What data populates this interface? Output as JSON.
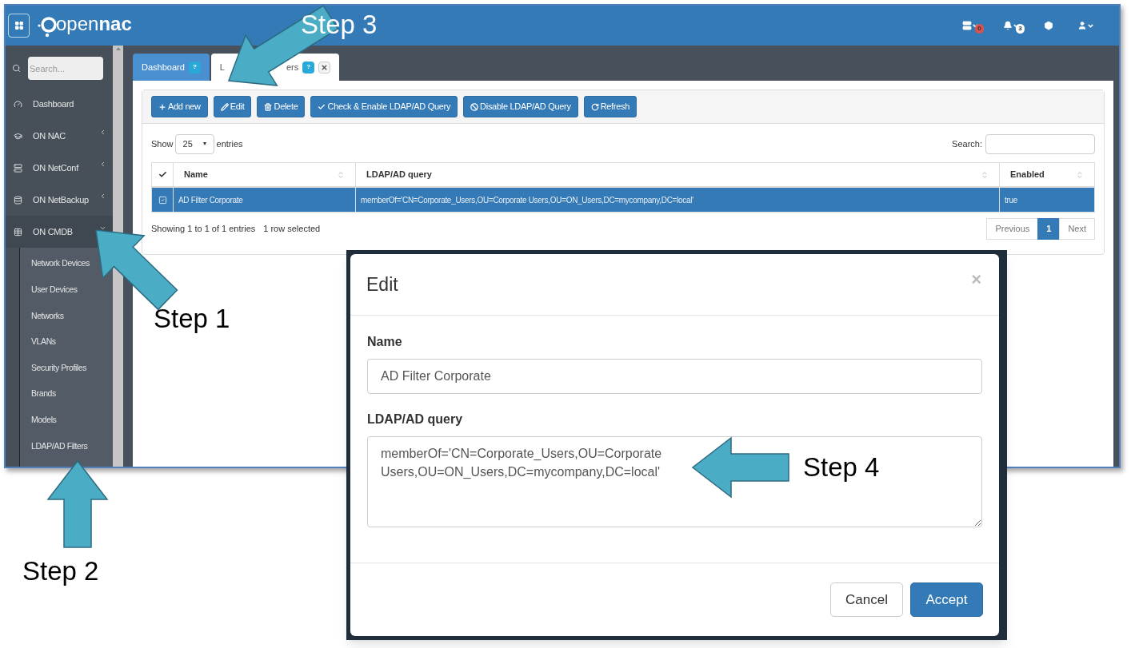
{
  "header": {
    "logo": "open**nac**",
    "icons": [
      {
        "kind": "server",
        "badge": "0",
        "color": "#d9534f"
      },
      {
        "kind": "bell",
        "badge": "3",
        "color": "#ffffff"
      },
      {
        "kind": "cube"
      },
      {
        "kind": "user"
      }
    ]
  },
  "sidebar": {
    "search": {
      "placeholder": "Search..."
    },
    "items": [
      {
        "label": "Dashboard",
        "kind": "dashboard",
        "collapsible": false
      },
      {
        "label": "ON NAC",
        "kind": "cap",
        "collapsible": true,
        "expanded": false
      },
      {
        "label": "ON NetConf",
        "kind": "server",
        "collapsible": true,
        "expanded": false
      },
      {
        "label": "ON NetBackup",
        "kind": "database",
        "collapsible": true,
        "expanded": false
      },
      {
        "label": "ON CMDB",
        "kind": "table",
        "collapsible": true,
        "expanded": true,
        "children": [
          {
            "label": "Network Devices"
          },
          {
            "label": "User Devices"
          },
          {
            "label": "Networks"
          },
          {
            "label": "VLANs"
          },
          {
            "label": "Security Profiles"
          },
          {
            "label": "Brands"
          },
          {
            "label": "Models"
          },
          {
            "label": "LDAP/AD Filters"
          }
        ]
      }
    ]
  },
  "tabs": [
    {
      "label_parts": [
        "Dashboard"
      ],
      "help": "?",
      "selected": false,
      "closable": false
    },
    {
      "label_parts": [
        "L",
        "ers"
      ],
      "help": "?",
      "selected": true,
      "closable": true
    }
  ],
  "toolbar": [
    {
      "kind": "add",
      "label": "Add new"
    },
    {
      "kind": "edit",
      "label": "Edit"
    },
    {
      "kind": "delete",
      "label": "Delete"
    },
    {
      "kind": "check",
      "label": "Check & Enable LDAP/AD Query"
    },
    {
      "kind": "disable",
      "label": "Disable LDAP/AD Query"
    },
    {
      "kind": "refresh",
      "label": "Refresh"
    }
  ],
  "table": {
    "length": {
      "before": "Show",
      "value": "25",
      "after": "entries"
    },
    "search_label": "Search:",
    "columns": [
      {
        "label": "Name"
      },
      {
        "label": "LDAP/AD query"
      },
      {
        "label": "Enabled"
      }
    ],
    "rows": [
      {
        "selected": true,
        "checked": true,
        "cells": [
          "AD Filter Corporate",
          "memberOf='CN=Corporate_Users,OU=Corporate Users,OU=ON_Users,DC=mycompany,DC=local'",
          "true"
        ]
      }
    ],
    "info": "Showing 1 to 1 of 1 entries",
    "selection_info": "1 row selected",
    "pagination": [
      {
        "label": "Previous",
        "selected": false
      },
      {
        "label": "1",
        "selected": true
      },
      {
        "label": "Next",
        "selected": false
      }
    ]
  },
  "dialog": {
    "title": "Edit",
    "close": "×",
    "fields": [
      {
        "kind": "input",
        "label": "Name",
        "value": "AD Filter Corporate"
      },
      {
        "kind": "textarea",
        "label": "LDAP/AD query",
        "value": "memberOf='CN=Corporate_Users,OU=Corporate Users,OU=ON_Users,DC=mycompany,DC=local'"
      }
    ],
    "buttons": [
      {
        "label": "Cancel",
        "primary": false
      },
      {
        "label": "Accept",
        "primary": true
      }
    ]
  },
  "annotations": [
    {
      "label": "Step 3",
      "color": "#ffffff"
    },
    {
      "label": "Step 1",
      "color": "#000000"
    },
    {
      "label": "Step 2",
      "color": "#000000"
    },
    {
      "label": "Step 4",
      "color": "#000000"
    }
  ]
}
